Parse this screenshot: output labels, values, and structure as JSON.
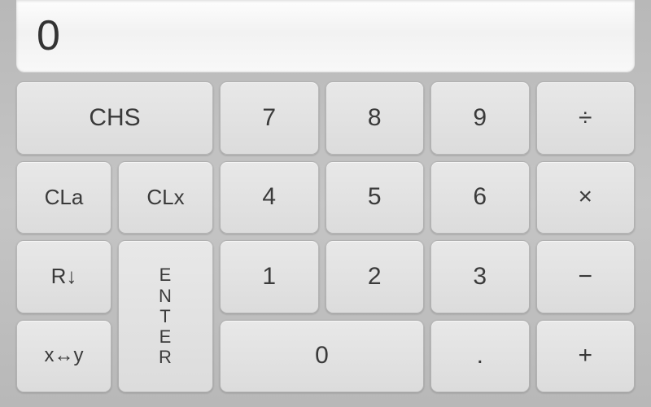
{
  "display": {
    "value": "0"
  },
  "keys": {
    "chs": "CHS",
    "seven": "7",
    "eight": "8",
    "nine": "9",
    "divide": "÷",
    "cla": "CLa",
    "clx": "CLx",
    "four": "4",
    "five": "5",
    "six": "6",
    "multiply": "×",
    "rdown": "R↓",
    "enter_1": "E",
    "enter_2": "N",
    "enter_3": "T",
    "enter_4": "E",
    "enter_5": "R",
    "one": "1",
    "two": "2",
    "three": "3",
    "subtract": "−",
    "xy": "x↔y",
    "zero": "0",
    "dot": ".",
    "add": "+"
  }
}
